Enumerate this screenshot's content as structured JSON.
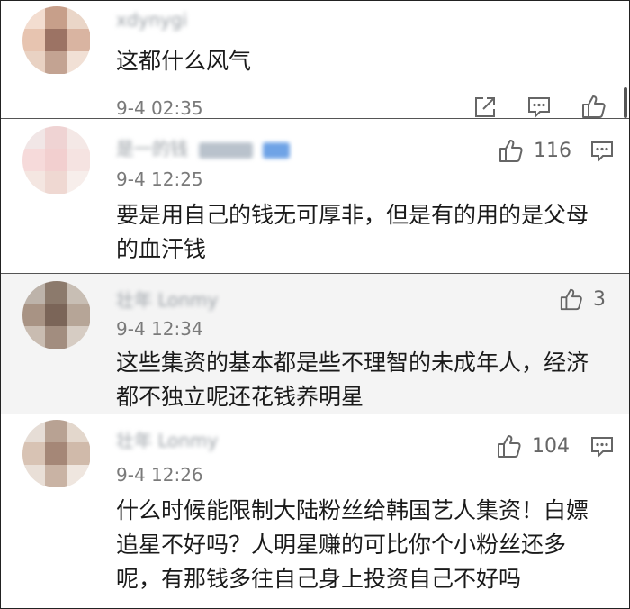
{
  "comments": [
    {
      "username": "xdynygi",
      "text": "这都什么风气",
      "time": "9-4 02:35",
      "likes": "",
      "icons": [
        "share-icon",
        "reply-icon",
        "like-icon"
      ]
    },
    {
      "username": "是一的钱",
      "text": "要是用自己的钱无可厚非，但是有的用的是父母的血汗钱",
      "time": "9-4 12:25",
      "likes": "116",
      "icons": [
        "like-icon",
        "reply-icon"
      ]
    },
    {
      "username": "壮年 Lonmy",
      "text": "这些集资的基本都是些不理智的未成年人，经济都不独立呢还花钱养明星",
      "time": "9-4 12:34",
      "likes": "3",
      "icons": [
        "like-icon"
      ]
    },
    {
      "username": "壮年 Lonmy",
      "text": "什么时候能限制大陆粉丝给韩国艺人集资！白嫖追星不好吗？人明星赚的可比你个小粉丝还多呢，有那钱多往自己身上投资自己不好吗",
      "time": "9-4 12:26",
      "likes": "104",
      "icons": [
        "like-icon",
        "reply-icon"
      ]
    }
  ]
}
